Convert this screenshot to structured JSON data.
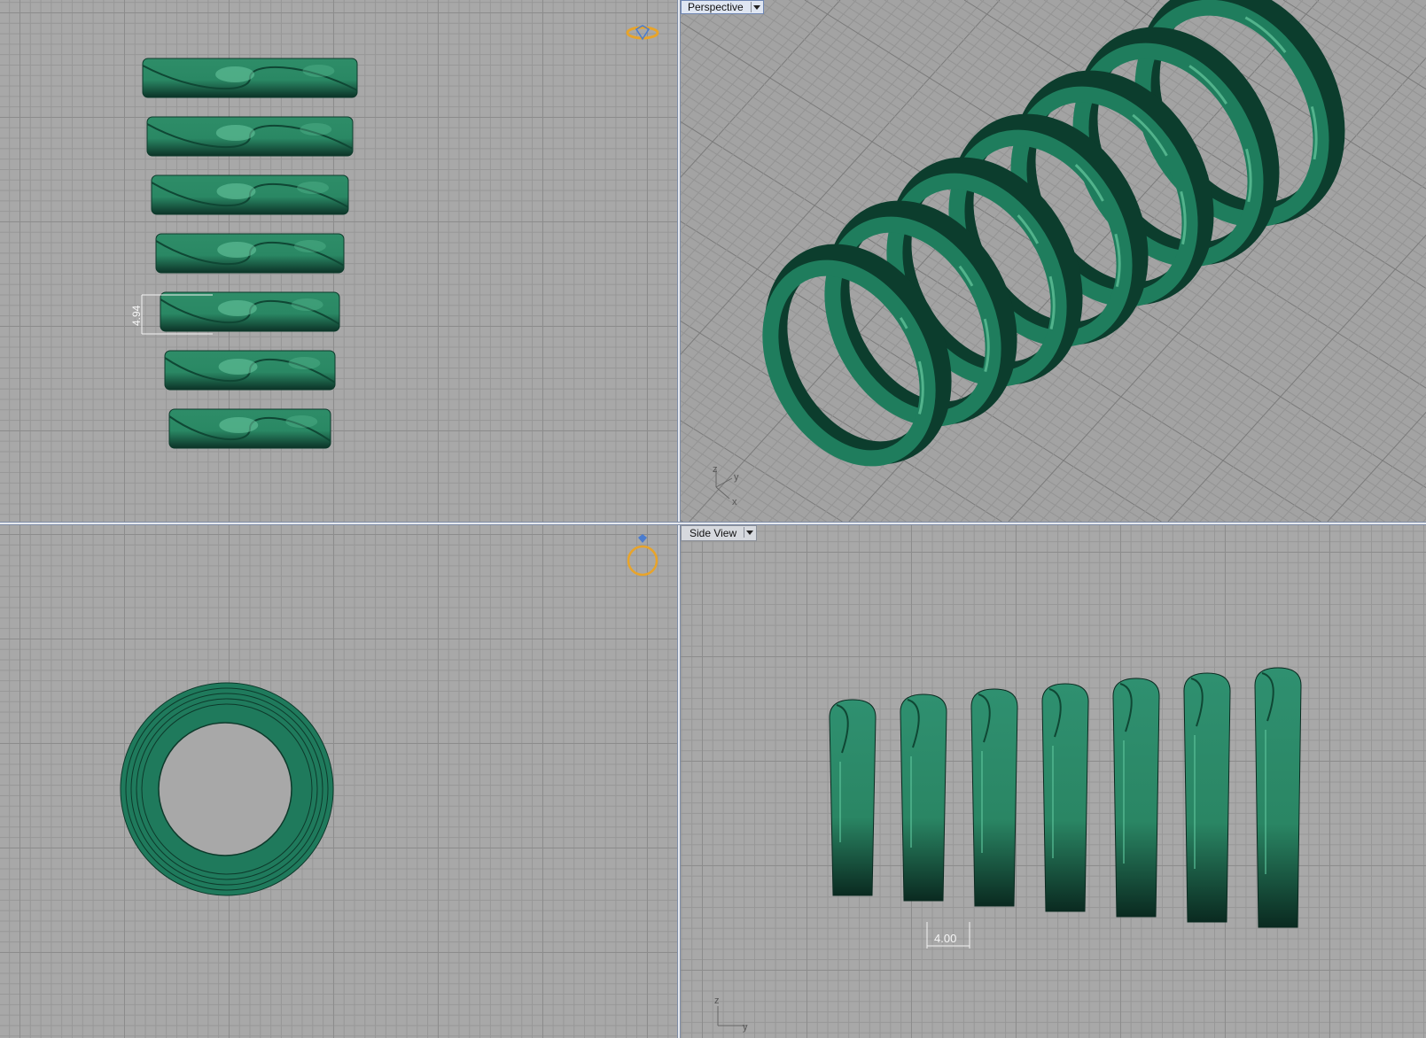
{
  "viewports": {
    "front": {
      "dimension_label": "4.94"
    },
    "perspective": {
      "title": "Perspective",
      "axes": {
        "z": "z",
        "y": "y",
        "x": "x"
      }
    },
    "top": {},
    "side": {
      "title": "Side View",
      "dimension_label": "4.00",
      "axes": {
        "z": "z",
        "y": "y"
      }
    }
  },
  "colors": {
    "ring": "#1f7a5c",
    "ring_dark": "#0d3a2b",
    "ring_light": "#5fb995",
    "grid_bg": "#a8a8a8",
    "gizmo": "#e8a42a"
  },
  "icons": [
    "ring-gizmo-icon",
    "ring-top-gizmo-icon",
    "dropdown-arrow-icon"
  ],
  "ring_count": 7
}
